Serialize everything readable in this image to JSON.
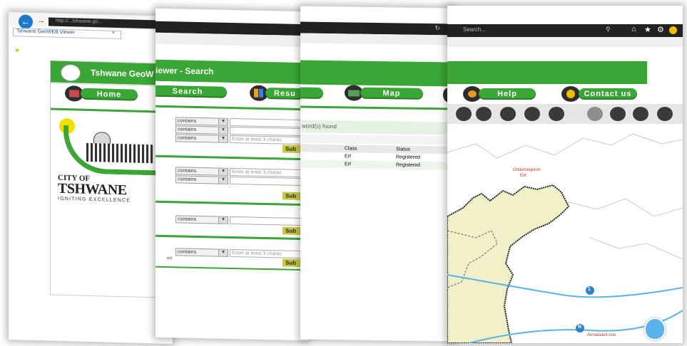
{
  "browser": {
    "url": "http://...tshwane.go...",
    "tab_title": "Tshwane GeoWEB Viewer",
    "search_placeholder": "Search..."
  },
  "app": {
    "header_title": "Tshwane GeoWEB Viewer - Search",
    "header_title_part1": "Tshwane GeoW",
    "header_title_part2": "iewer - Search"
  },
  "nav": {
    "home": "Home",
    "search": "Search",
    "results": "Resu",
    "map": "Map",
    "help": "Help",
    "contact": "Contact us"
  },
  "logo": {
    "city_of": "CITY OF",
    "tshwane": "TSHWANE",
    "tagline": "IGNITING EXCELLENCE"
  },
  "search_form": {
    "operator": "contains",
    "hint": "Enter at least 3 charac",
    "submit": "Sub",
    "side_label": "ed:"
  },
  "results": {
    "found_text": "word(s) found",
    "columns": [
      "Class",
      "Status"
    ],
    "rows": [
      [
        "Erf",
        "Registered"
      ],
      [
        "Erf",
        "Registered"
      ]
    ]
  },
  "map": {
    "place_top": "Onderstepoort",
    "place_top2": "Ext",
    "place_bottom": "Annadale/Lorie",
    "road_badge_1": "1",
    "road_badge_2": "N",
    "colors": {
      "brand_green": "#3aa635",
      "highlight_area": "#f2f0c8",
      "road": "#5ab4ea"
    }
  }
}
